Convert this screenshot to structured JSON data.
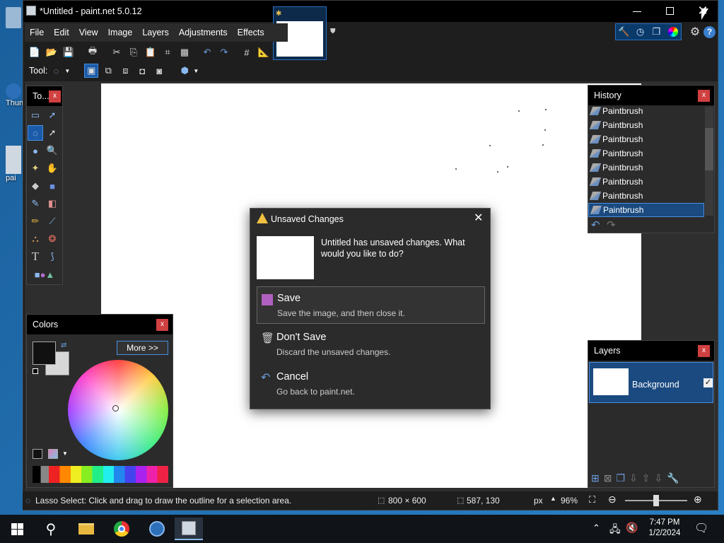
{
  "window": {
    "title": "*Untitled - paint.net 5.0.12"
  },
  "desktop": {
    "icon1": "Thun",
    "icon2": "pai"
  },
  "menu": [
    "File",
    "Edit",
    "View",
    "Image",
    "Layers",
    "Adjustments",
    "Effects"
  ],
  "toolbar": {
    "tool_label": "Tool:"
  },
  "tools_panel": {
    "title": "To...",
    "close": "x"
  },
  "history": {
    "title": "History",
    "close": "x",
    "items": [
      "Paintbrush",
      "Paintbrush",
      "Paintbrush",
      "Paintbrush",
      "Paintbrush",
      "Paintbrush",
      "Paintbrush",
      "Paintbrush"
    ]
  },
  "colors": {
    "title": "Colors",
    "close": "x",
    "more_button": "More >>"
  },
  "layers": {
    "title": "Layers",
    "close": "x",
    "layer_name": "Background"
  },
  "dialog": {
    "title": "Unsaved Changes",
    "message": "Untitled has unsaved changes. What would you like to do?",
    "options": [
      {
        "heading": "Save",
        "sub": "Save the image, and then close it."
      },
      {
        "heading": "Don't Save",
        "sub": "Discard the unsaved changes."
      },
      {
        "heading": "Cancel",
        "sub": "Go back to paint.net."
      }
    ]
  },
  "status": {
    "hint": "Lasso Select: Click and drag to draw the outline for a selection area.",
    "size": "800 × 600",
    "cursor": "587, 130",
    "unit": "px",
    "zoom": "96%"
  },
  "taskbar": {
    "time": "7:47 PM",
    "date": "1/2/2024"
  },
  "colors_hex": {
    "accent": "#0a64c8",
    "danger": "#d04040",
    "panel": "#2b2b2b",
    "titlebar": "#000000"
  }
}
